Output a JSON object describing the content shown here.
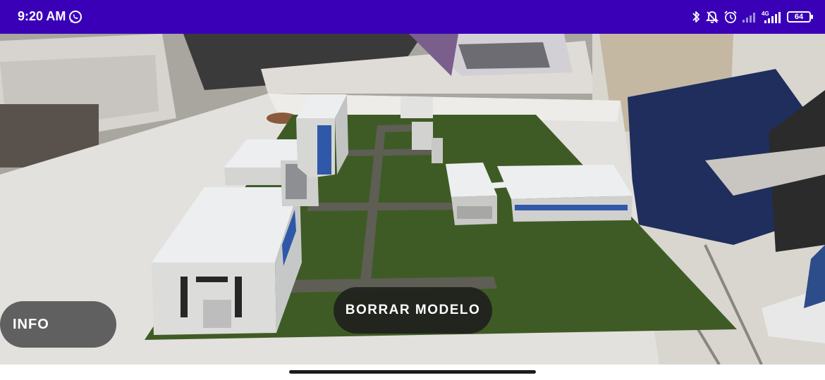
{
  "status_bar": {
    "time": "9:20 AM",
    "battery_level": "64",
    "network_label": "4G",
    "background_color": "#3a00b8",
    "icons": [
      "whatsapp-icon",
      "bluetooth-icon",
      "mute-icon",
      "alarm-icon",
      "wifi-signal-icon",
      "cell-signal-icon",
      "battery-icon"
    ]
  },
  "ar_view": {
    "scene": "campus-model-on-table",
    "ground_color": "#3f5b25",
    "path_color": "#5e5e55"
  },
  "buttons": {
    "info_label": "INFO",
    "delete_model_label": "BORRAR MODELO"
  },
  "nav": {
    "gesture_handle": "gesture-handle"
  }
}
